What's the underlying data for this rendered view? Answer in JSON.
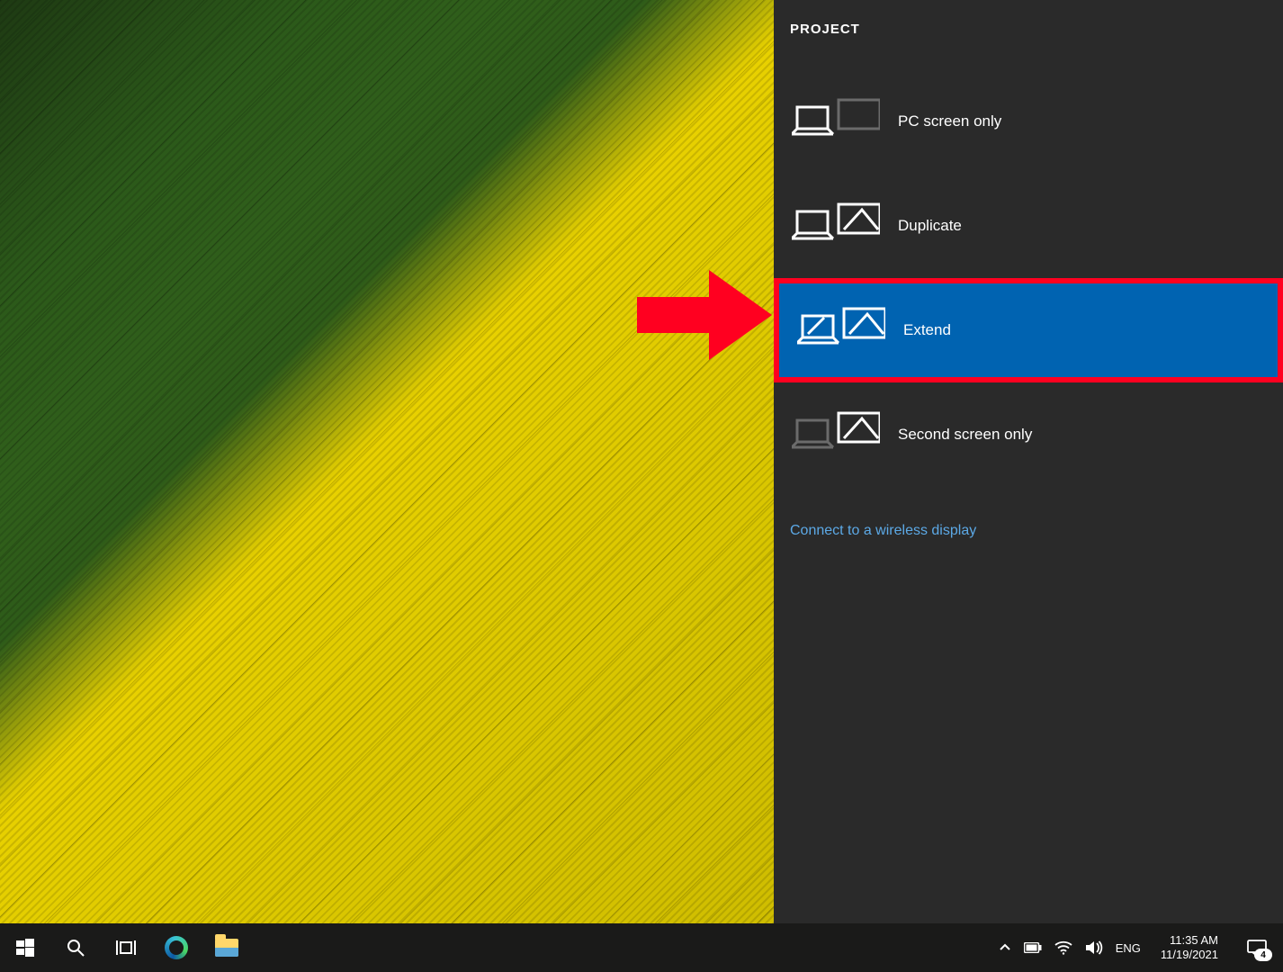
{
  "panel": {
    "title": "PROJECT",
    "options": [
      {
        "label": "PC screen only",
        "kind": "pc-only",
        "selected": false
      },
      {
        "label": "Duplicate",
        "kind": "duplicate",
        "selected": false
      },
      {
        "label": "Extend",
        "kind": "extend",
        "selected": true
      },
      {
        "label": "Second screen only",
        "kind": "second-only",
        "selected": false
      }
    ],
    "connect_link": "Connect to a wireless display"
  },
  "annotation": {
    "arrow_color": "#ff0020",
    "highlight_color": "#ff0020"
  },
  "taskbar": {
    "language": "ENG",
    "time": "11:35 AM",
    "date": "11/19/2021",
    "action_center_badge": "4"
  }
}
